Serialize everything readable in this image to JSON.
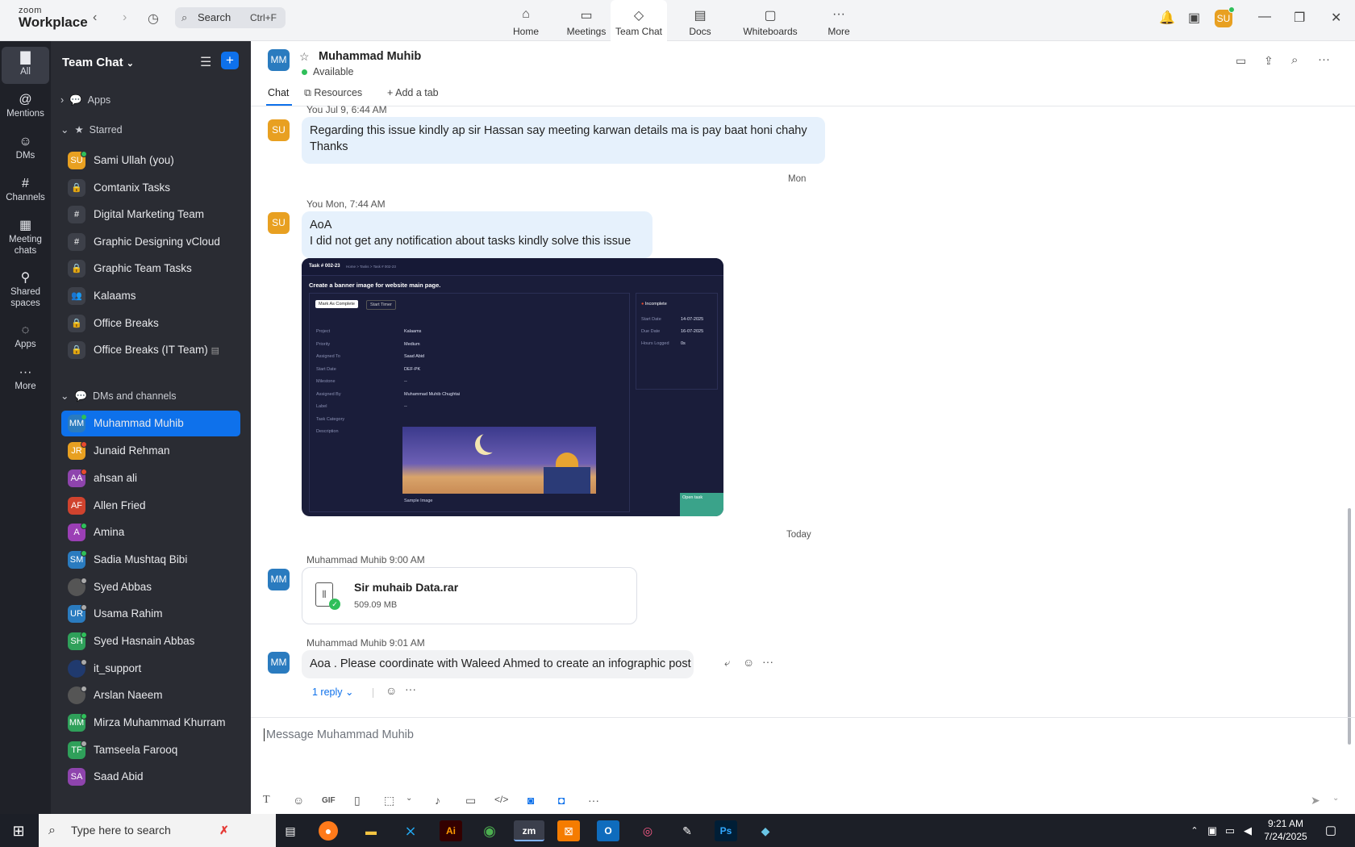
{
  "app": {
    "brand_top": "zoom",
    "brand_bottom": "Workplace"
  },
  "search": {
    "label": "Search",
    "shortcut": "Ctrl+F"
  },
  "nav_tabs": [
    {
      "label": "Home",
      "icon": "home-icon",
      "glyph": "⌂"
    },
    {
      "label": "Meetings",
      "icon": "video-icon",
      "glyph": "▭"
    },
    {
      "label": "Team Chat",
      "icon": "chat-icon",
      "glyph": "◇"
    },
    {
      "label": "Docs",
      "icon": "doc-icon",
      "glyph": "▤"
    },
    {
      "label": "Whiteboards",
      "icon": "whiteboard-icon",
      "glyph": "▢"
    },
    {
      "label": "More",
      "icon": "more-icon",
      "glyph": "···"
    }
  ],
  "user_avatar": "SU",
  "rail": [
    {
      "label": "All",
      "glyph": "▇"
    },
    {
      "label": "Mentions",
      "glyph": "@"
    },
    {
      "label": "DMs",
      "glyph": "☺"
    },
    {
      "label": "Channels",
      "glyph": "#"
    },
    {
      "label": "Meeting chats",
      "glyph": "▦"
    },
    {
      "label": "Shared spaces",
      "glyph": "⚲"
    },
    {
      "label": "Apps",
      "glyph": "◌"
    },
    {
      "label": "More",
      "glyph": "···"
    }
  ],
  "sidebar": {
    "title": "Team Chat",
    "sections": {
      "apps": "Apps",
      "starred": "Starred",
      "dms": "DMs and channels"
    },
    "starred": [
      {
        "label": "Sami Ullah (you)",
        "avatar": "SU",
        "color": "#e8a021",
        "type": "avatar"
      },
      {
        "label": "Comtanix Tasks",
        "glyph": "🔒",
        "type": "lock"
      },
      {
        "label": "Digital Marketing Team",
        "glyph": "#",
        "type": "hash"
      },
      {
        "label": "Graphic Designing vCloud",
        "glyph": "#",
        "type": "hash"
      },
      {
        "label": "Graphic Team Tasks",
        "glyph": "🔒",
        "type": "lock"
      },
      {
        "label": "Kalaams",
        "glyph": "👥",
        "type": "group"
      },
      {
        "label": "Office Breaks",
        "glyph": "🔒",
        "type": "lock"
      },
      {
        "label": "Office Breaks (IT Team)",
        "glyph": "🔒",
        "type": "lock"
      }
    ],
    "dms": [
      {
        "label": "Muhammad Muhib",
        "avatar": "MM",
        "color": "#2a7bbf"
      },
      {
        "label": "Junaid Rehman",
        "avatar": "JR",
        "color": "#e8a021"
      },
      {
        "label": "ahsan ali",
        "avatar": "AA",
        "color": "#8e44ad"
      },
      {
        "label": "Allen Fried",
        "avatar": "AF",
        "color": "#d0432e"
      },
      {
        "label": "Amina",
        "avatar": "A",
        "color": "#9b3fb5"
      },
      {
        "label": "Sadia Mushtaq Bibi",
        "avatar": "SM",
        "color": "#2a7bbf"
      },
      {
        "label": "Syed Abbas",
        "avatar": "",
        "color": "#555"
      },
      {
        "label": "Usama Rahim",
        "avatar": "UR",
        "color": "#2a7bbf"
      },
      {
        "label": "Syed Hasnain Abbas",
        "avatar": "SH",
        "color": "#2fa05a"
      },
      {
        "label": "it_support",
        "avatar": "",
        "color": "#203a6e"
      },
      {
        "label": "Arslan Naeem",
        "avatar": "",
        "color": "#555"
      },
      {
        "label": "Mirza Muhammad Khurram",
        "avatar": "MM",
        "color": "#2fa05a"
      },
      {
        "label": "Tamseela Farooq",
        "avatar": "TF",
        "color": "#2fa05a"
      },
      {
        "label": "Saad Abid",
        "avatar": "SA",
        "color": "#8e44ad"
      }
    ]
  },
  "chat": {
    "contact": "Muhammad Muhib",
    "contact_avatar": "MM",
    "status": "Available",
    "tabs": {
      "chat": "Chat",
      "resources": "Resources",
      "add": "Add a tab"
    },
    "msg1": {
      "meta": "You Jul 9, 6:44 AM",
      "avatar": "SU",
      "line1": "Regarding this issue kindly ap sir Hassan say meeting karwan details ma is pay baat honi chahy",
      "line2": "Thanks"
    },
    "sep1": "Mon",
    "msg2": {
      "meta": "You Mon, 7:44 AM",
      "avatar": "SU",
      "line1": "AoA",
      "line2": "I did not get any notification about tasks kindly solve this issue"
    },
    "screenshot": {
      "title": "Task # 002-23",
      "crumb": "Home > Tasks > Task # 002-23",
      "heading": "Create a banner image for website main page.",
      "btn1": "Mark As Complete",
      "btn2": "Start Timer",
      "fields": [
        "Project",
        "Priority",
        "Assigned To",
        "Start Date",
        "Milestone",
        "Assigned By",
        "Label",
        "Task Category",
        "Description"
      ],
      "values": [
        "Kalaams",
        "Medium",
        "Saad Abid",
        "DEF-PK",
        "--",
        "Muhammad Muhib Chughtai",
        "--",
        "",
        ""
      ],
      "status": "Incomplete",
      "side_labels": [
        "Start Date",
        "Due Date",
        "Hours Logged"
      ],
      "side_values": [
        "14-07-2025",
        "16-07-2025",
        "0s"
      ],
      "caption": "Sample Image",
      "badge": "Open task"
    },
    "sep2": "Today",
    "msg3": {
      "meta": "Muhammad Muhib 9:00 AM",
      "avatar": "MM",
      "file_name": "Sir muhaib Data.rar",
      "file_size": "509.09 MB"
    },
    "msg4": {
      "meta": "Muhammad Muhib 9:01 AM",
      "avatar": "MM",
      "text": "Aoa . Please coordinate with Waleed Ahmed to create an infographic post",
      "reply": "1 reply"
    },
    "composer_placeholder": "Message Muhammad Muhib"
  },
  "taskbar": {
    "search": "Type here to search",
    "time": "9:21 AM",
    "date": "7/24/2025"
  }
}
